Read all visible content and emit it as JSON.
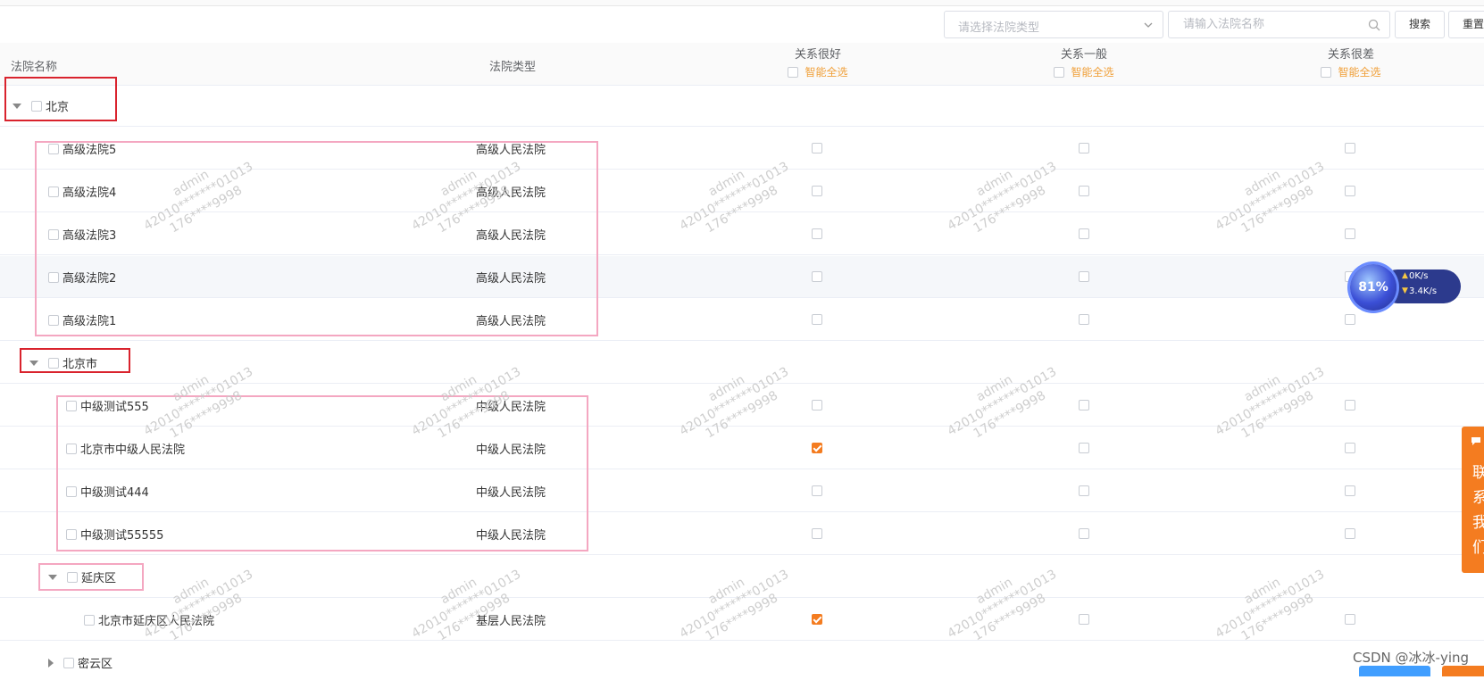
{
  "toolbar": {
    "court_type_placeholder": "请选择法院类型",
    "court_name_placeholder": "请输入法院名称",
    "search_label": "搜索",
    "reset_label": "重置"
  },
  "table": {
    "headers": {
      "name": "法院名称",
      "type": "法院类型",
      "col1": "关系很好",
      "col2": "关系一般",
      "col3": "关系很差",
      "select_all": "智能全选"
    },
    "rows": [
      {
        "label": "北京",
        "kind": "group",
        "expanded": true
      },
      {
        "label": "高级法院5",
        "type": "高级人民法院",
        "c1": false,
        "c2": false,
        "c3": false
      },
      {
        "label": "高级法院4",
        "type": "高级人民法院",
        "c1": false,
        "c2": false,
        "c3": false
      },
      {
        "label": "高级法院3",
        "type": "高级人民法院",
        "c1": false,
        "c2": false,
        "c3": false
      },
      {
        "label": "高级法院2",
        "type": "高级人民法院",
        "c1": false,
        "c2": false,
        "c3": false
      },
      {
        "label": "高级法院1",
        "type": "高级人民法院",
        "c1": false,
        "c2": false,
        "c3": false
      },
      {
        "label": "北京市",
        "kind": "group",
        "expanded": true
      },
      {
        "label": "中级测试555",
        "type": "中级人民法院",
        "c1": false,
        "c2": false,
        "c3": false
      },
      {
        "label": "北京市中级人民法院",
        "type": "中级人民法院",
        "c1": true,
        "c2": false,
        "c3": false
      },
      {
        "label": "中级测试444",
        "type": "中级人民法院",
        "c1": false,
        "c2": false,
        "c3": false
      },
      {
        "label": "中级测试55555",
        "type": "中级人民法院",
        "c1": false,
        "c2": false,
        "c3": false
      },
      {
        "label": "延庆区",
        "kind": "group",
        "expanded": true
      },
      {
        "label": "北京市延庆区人民法院",
        "type": "基层人民法院",
        "c1": true,
        "c2": false,
        "c3": false
      },
      {
        "label": "密云区",
        "kind": "group",
        "expanded": false
      }
    ]
  },
  "watermark": {
    "line1": "admin",
    "line2": "42010*******01013",
    "line3": "176****9998"
  },
  "speed_widget": {
    "percent": "81%",
    "up": "0K/s",
    "down": "3.4K/s"
  },
  "side_tab": {
    "text": "联系我们"
  },
  "credit": "CSDN @冰冰-ying",
  "colors": {
    "accent": "#f47c20",
    "red_box": "#d9232d",
    "pink_box": "#f4a7c1"
  }
}
